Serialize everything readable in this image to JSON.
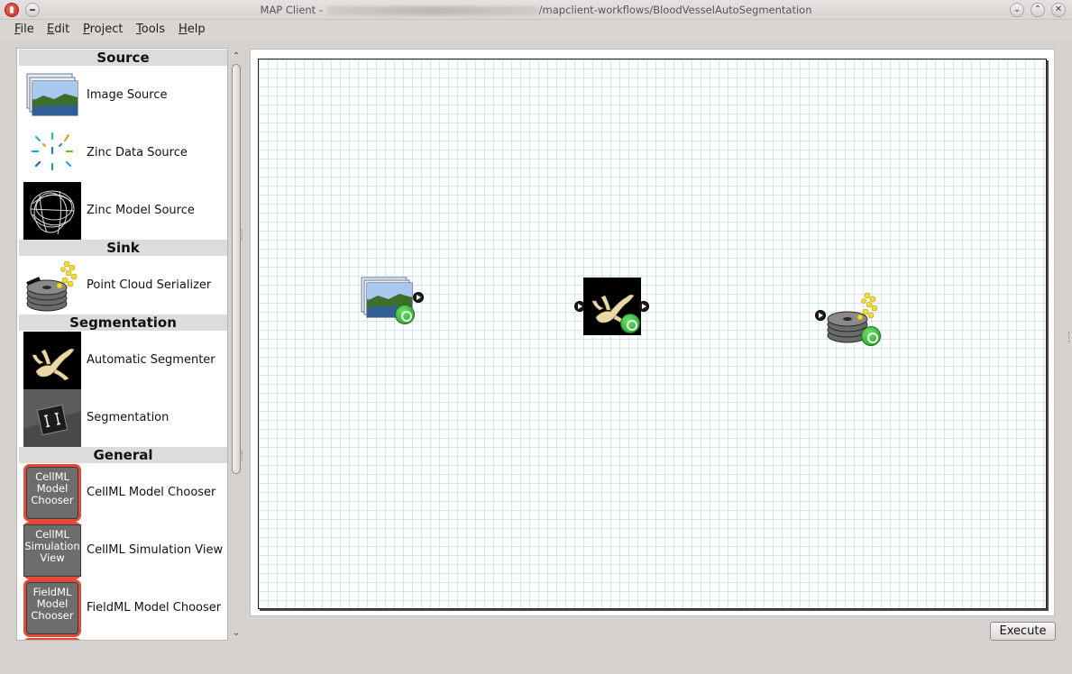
{
  "window": {
    "title_prefix": "MAP Client - ",
    "title_suffix": "/mapclient-workflows/BloodVesselAutoSegmentation",
    "controls": {
      "minimize": "⌄",
      "maximize": "⌃",
      "close": "✕"
    }
  },
  "menu": {
    "items": [
      {
        "first": "F",
        "rest": "ile"
      },
      {
        "first": "E",
        "rest": "dit"
      },
      {
        "first": "P",
        "rest": "roject"
      },
      {
        "first": "T",
        "rest": "ools"
      },
      {
        "first": "H",
        "rest": "elp"
      }
    ]
  },
  "sidebar": {
    "categories": {
      "source": "Source",
      "sink": "Sink",
      "segmentation": "Segmentation",
      "general": "General"
    },
    "steps": {
      "image_source": "Image Source",
      "zinc_data_source": "Zinc Data Source",
      "zinc_model_source": "Zinc Model Source",
      "point_cloud_serializer": "Point Cloud Serializer",
      "automatic_segmenter": "Automatic Segmenter",
      "segmentation": "Segmentation",
      "cellml_model_chooser": "CellML Model Chooser",
      "cellml_simulation_view": "CellML Simulation View",
      "fieldml_model_chooser": "FieldML Model Chooser"
    },
    "thumb_text": {
      "cellml_chooser": [
        "CellML",
        "Model",
        "Chooser"
      ],
      "cellml_sim": [
        "CellML",
        "Simulation",
        "View"
      ],
      "fieldml_chooser": [
        "FieldML",
        "Model",
        "Chooser"
      ]
    },
    "scroll": {
      "up": "⌃",
      "down": "⌄"
    }
  },
  "workflow": {
    "nodes": [
      "Image Source",
      "Automatic Segmenter",
      "Point Cloud Serializer"
    ]
  },
  "execute_label": "Execute",
  "colors": {
    "grid_line": "#cfe6f4",
    "accent_red": "#e24b36",
    "gear_green": "#2ea62f"
  }
}
